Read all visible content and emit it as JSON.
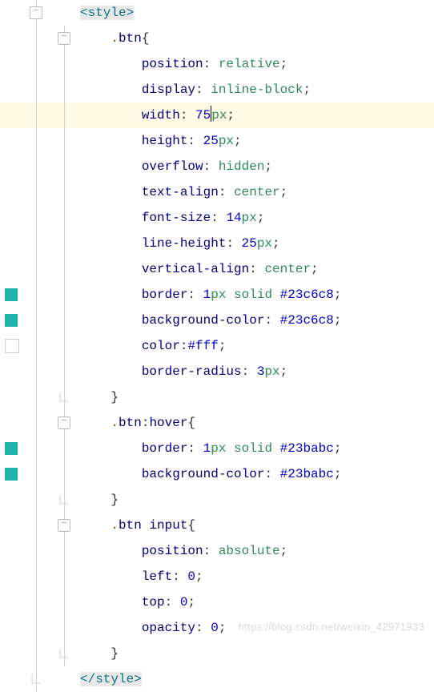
{
  "watermark": "https://blog.csdn.net/weixin_42971933",
  "cursor_line_index": 4,
  "lines": [
    {
      "indent": 0,
      "marker": null,
      "fold": "open",
      "fold2": null,
      "tokens": [
        {
          "t": "tag",
          "v": "<style>"
        }
      ]
    },
    {
      "indent": 1,
      "marker": null,
      "fold": "line",
      "fold2": "open",
      "tokens": [
        {
          "t": "sel",
          "v": "."
        },
        {
          "t": "selname",
          "v": "btn"
        },
        {
          "t": "brace",
          "v": "{"
        }
      ]
    },
    {
      "indent": 2,
      "marker": null,
      "fold": "line",
      "fold2": "line",
      "tokens": [
        {
          "t": "prop",
          "v": "position"
        },
        {
          "t": "colon",
          "v": ": "
        },
        {
          "t": "kw",
          "v": "relative"
        },
        {
          "t": "punct",
          "v": ";"
        }
      ]
    },
    {
      "indent": 2,
      "marker": null,
      "fold": "line",
      "fold2": "line",
      "tokens": [
        {
          "t": "prop",
          "v": "display"
        },
        {
          "t": "colon",
          "v": ": "
        },
        {
          "t": "kw",
          "v": "inline-block"
        },
        {
          "t": "punct",
          "v": ";"
        }
      ]
    },
    {
      "indent": 2,
      "marker": null,
      "fold": "line",
      "fold2": "line",
      "highlight": true,
      "tokens": [
        {
          "t": "prop",
          "v": "width"
        },
        {
          "t": "colon",
          "v": ": "
        },
        {
          "t": "num",
          "v": "75"
        },
        {
          "t": "cursor",
          "v": ""
        },
        {
          "t": "unit",
          "v": "px"
        },
        {
          "t": "punct",
          "v": ";"
        }
      ]
    },
    {
      "indent": 2,
      "marker": null,
      "fold": "line",
      "fold2": "line",
      "tokens": [
        {
          "t": "prop",
          "v": "height"
        },
        {
          "t": "colon",
          "v": ": "
        },
        {
          "t": "num",
          "v": "25"
        },
        {
          "t": "unit",
          "v": "px"
        },
        {
          "t": "punct",
          "v": ";"
        }
      ]
    },
    {
      "indent": 2,
      "marker": null,
      "fold": "line",
      "fold2": "line",
      "tokens": [
        {
          "t": "prop",
          "v": "overflow"
        },
        {
          "t": "colon",
          "v": ": "
        },
        {
          "t": "kw",
          "v": "hidden"
        },
        {
          "t": "punct",
          "v": ";"
        }
      ]
    },
    {
      "indent": 2,
      "marker": null,
      "fold": "line",
      "fold2": "line",
      "tokens": [
        {
          "t": "prop",
          "v": "text-align"
        },
        {
          "t": "colon",
          "v": ": "
        },
        {
          "t": "kw",
          "v": "center"
        },
        {
          "t": "punct",
          "v": ";"
        }
      ]
    },
    {
      "indent": 2,
      "marker": null,
      "fold": "line",
      "fold2": "line",
      "tokens": [
        {
          "t": "prop",
          "v": "font-size"
        },
        {
          "t": "colon",
          "v": ": "
        },
        {
          "t": "num",
          "v": "14"
        },
        {
          "t": "unit",
          "v": "px"
        },
        {
          "t": "punct",
          "v": ";"
        }
      ]
    },
    {
      "indent": 2,
      "marker": null,
      "fold": "line",
      "fold2": "line",
      "tokens": [
        {
          "t": "prop",
          "v": "line-height"
        },
        {
          "t": "colon",
          "v": ": "
        },
        {
          "t": "num",
          "v": "25"
        },
        {
          "t": "unit",
          "v": "px"
        },
        {
          "t": "punct",
          "v": ";"
        }
      ]
    },
    {
      "indent": 2,
      "marker": null,
      "fold": "line",
      "fold2": "line",
      "tokens": [
        {
          "t": "prop",
          "v": "vertical-align"
        },
        {
          "t": "colon",
          "v": ": "
        },
        {
          "t": "kw",
          "v": "center"
        },
        {
          "t": "punct",
          "v": ";"
        }
      ]
    },
    {
      "indent": 2,
      "marker": "filled",
      "fold": "line",
      "fold2": "line",
      "tokens": [
        {
          "t": "prop",
          "v": "border"
        },
        {
          "t": "colon",
          "v": ": "
        },
        {
          "t": "num",
          "v": "1"
        },
        {
          "t": "unit",
          "v": "px "
        },
        {
          "t": "kw",
          "v": "solid "
        },
        {
          "t": "hex",
          "v": "#23c6c8"
        },
        {
          "t": "punct",
          "v": ";"
        }
      ]
    },
    {
      "indent": 2,
      "marker": "filled",
      "fold": "line",
      "fold2": "line",
      "tokens": [
        {
          "t": "prop",
          "v": "background-color"
        },
        {
          "t": "colon",
          "v": ": "
        },
        {
          "t": "hex",
          "v": "#23c6c8"
        },
        {
          "t": "punct",
          "v": ";"
        }
      ]
    },
    {
      "indent": 2,
      "marker": "hollow",
      "fold": "line",
      "fold2": "line",
      "tokens": [
        {
          "t": "prop",
          "v": "color"
        },
        {
          "t": "colon",
          "v": ":"
        },
        {
          "t": "hex",
          "v": "#fff"
        },
        {
          "t": "punct",
          "v": ";"
        }
      ]
    },
    {
      "indent": 2,
      "marker": null,
      "fold": "line",
      "fold2": "line",
      "tokens": [
        {
          "t": "prop",
          "v": "border-radius"
        },
        {
          "t": "colon",
          "v": ": "
        },
        {
          "t": "num",
          "v": "3"
        },
        {
          "t": "unit",
          "v": "px"
        },
        {
          "t": "punct",
          "v": ";"
        }
      ]
    },
    {
      "indent": 1,
      "marker": null,
      "fold": "line",
      "fold2": "end",
      "tokens": [
        {
          "t": "brace",
          "v": "}"
        }
      ]
    },
    {
      "indent": 1,
      "marker": null,
      "fold": "line",
      "fold2": "open",
      "tokens": [
        {
          "t": "sel",
          "v": "."
        },
        {
          "t": "selname",
          "v": "btn"
        },
        {
          "t": "colon",
          "v": ":"
        },
        {
          "t": "selname",
          "v": "hover"
        },
        {
          "t": "brace",
          "v": "{"
        }
      ]
    },
    {
      "indent": 2,
      "marker": "filled",
      "fold": "line",
      "fold2": "line",
      "tokens": [
        {
          "t": "prop",
          "v": "border"
        },
        {
          "t": "colon",
          "v": ": "
        },
        {
          "t": "num",
          "v": "1"
        },
        {
          "t": "unit",
          "v": "px "
        },
        {
          "t": "kw",
          "v": "solid "
        },
        {
          "t": "hex",
          "v": "#23babc"
        },
        {
          "t": "punct",
          "v": ";"
        }
      ]
    },
    {
      "indent": 2,
      "marker": "filled",
      "fold": "line",
      "fold2": "line",
      "tokens": [
        {
          "t": "prop",
          "v": "background-color"
        },
        {
          "t": "colon",
          "v": ": "
        },
        {
          "t": "hex",
          "v": "#23babc"
        },
        {
          "t": "punct",
          "v": ";"
        }
      ]
    },
    {
      "indent": 1,
      "marker": null,
      "fold": "line",
      "fold2": "end",
      "tokens": [
        {
          "t": "brace",
          "v": "}"
        }
      ]
    },
    {
      "indent": 1,
      "marker": null,
      "fold": "line",
      "fold2": "open",
      "tokens": [
        {
          "t": "sel",
          "v": "."
        },
        {
          "t": "selname",
          "v": "btn "
        },
        {
          "t": "selname",
          "v": "input"
        },
        {
          "t": "brace",
          "v": "{"
        }
      ]
    },
    {
      "indent": 2,
      "marker": null,
      "fold": "line",
      "fold2": "line",
      "tokens": [
        {
          "t": "prop",
          "v": "position"
        },
        {
          "t": "colon",
          "v": ": "
        },
        {
          "t": "kw",
          "v": "absolute"
        },
        {
          "t": "punct",
          "v": ";"
        }
      ]
    },
    {
      "indent": 2,
      "marker": null,
      "fold": "line",
      "fold2": "line",
      "tokens": [
        {
          "t": "prop",
          "v": "left"
        },
        {
          "t": "colon",
          "v": ": "
        },
        {
          "t": "num",
          "v": "0"
        },
        {
          "t": "punct",
          "v": ";"
        }
      ]
    },
    {
      "indent": 2,
      "marker": null,
      "fold": "line",
      "fold2": "line",
      "tokens": [
        {
          "t": "prop",
          "v": "top"
        },
        {
          "t": "colon",
          "v": ": "
        },
        {
          "t": "num",
          "v": "0"
        },
        {
          "t": "punct",
          "v": ";"
        }
      ]
    },
    {
      "indent": 2,
      "marker": null,
      "fold": "line",
      "fold2": "line",
      "tokens": [
        {
          "t": "prop",
          "v": "opacity"
        },
        {
          "t": "colon",
          "v": ": "
        },
        {
          "t": "num",
          "v": "0"
        },
        {
          "t": "punct",
          "v": ";"
        }
      ]
    },
    {
      "indent": 1,
      "marker": null,
      "fold": "line",
      "fold2": "end",
      "tokens": [
        {
          "t": "brace",
          "v": "}"
        }
      ]
    },
    {
      "indent": 0,
      "marker": null,
      "fold": "end",
      "fold2": null,
      "tokens": [
        {
          "t": "tag",
          "v": "</style>"
        }
      ]
    }
  ]
}
